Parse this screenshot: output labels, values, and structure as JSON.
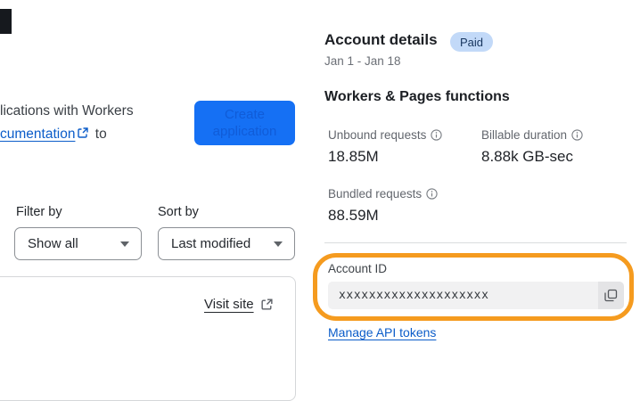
{
  "left": {
    "intro_line1": "lications with Workers",
    "intro_link_text": "cumentation",
    "intro_suffix": " to",
    "create_button_label": "Create application",
    "filter_label": "Filter by",
    "filter_value": "Show all",
    "sort_label": "Sort by",
    "sort_value": "Last modified",
    "visit_site_label": "Visit site"
  },
  "account": {
    "title": "Account details",
    "badge": "Paid",
    "date_range": "Jan 1 - Jan 18",
    "section_title": "Workers & Pages functions",
    "metrics": [
      {
        "label": "Unbound requests",
        "value": "18.85M"
      },
      {
        "label": "Billable duration",
        "value": "8.88k GB-sec"
      },
      {
        "label": "Bundled requests",
        "value": "88.59M"
      }
    ],
    "account_id_label": "Account ID",
    "account_id_value": "xxxxxxxxxxxxxxxxxxxx",
    "manage_link_label": "Manage API tokens"
  },
  "colors": {
    "accent_blue": "#1570f4",
    "link_blue": "#0b5cc9",
    "badge_bg": "#c2d9f8",
    "annotation_orange": "#f59b1f"
  }
}
